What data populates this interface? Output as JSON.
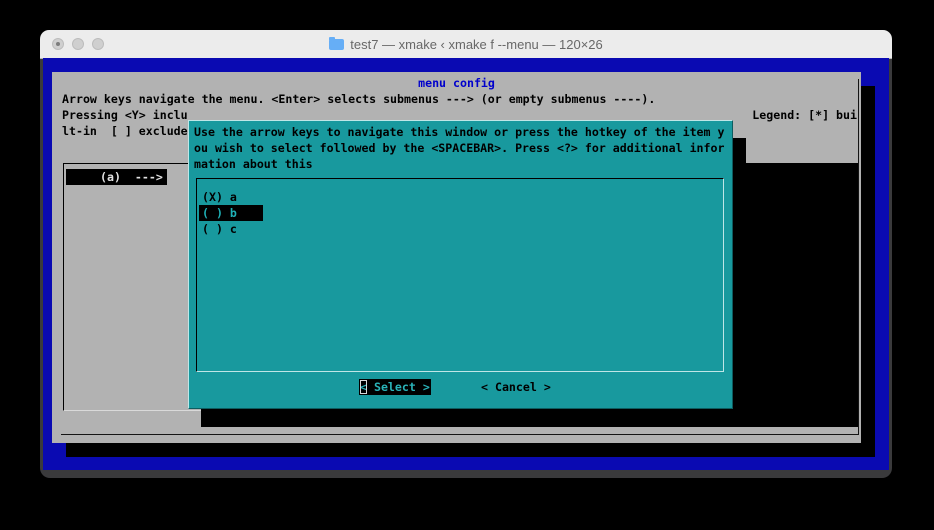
{
  "window": {
    "title": "test7 — xmake ‹ xmake f --menu — 120×26"
  },
  "screen": {
    "dialog_title": "menu config",
    "line1": "Arrow keys navigate the menu. <Enter> selects submenus ---> (or empty submenus ----).",
    "line2_left": "Pressing <Y> inclu",
    "line2_right": "Legend: [*] bui",
    "line3_left": "lt-in  [ ] exclude",
    "selected_menu_item": "(a)  --->",
    "colors": {
      "terminal_bg": "#0a0ab2",
      "dialog_bg": "#b2b2b2",
      "popup_bg": "#18999e",
      "dialog_title_fg": "#0000cc",
      "shadow": "#000000"
    }
  },
  "popup": {
    "text_lines": [
      "Use the arrow keys to navigate this window or press the hotkey of the item y",
      "ou wish to select followed by the <SPACEBAR>. Press <?> for additional infor",
      "mation about this"
    ],
    "options": [
      {
        "label": "(X) a"
      },
      {
        "label": "( ) b"
      },
      {
        "label": "( ) c"
      }
    ],
    "selected_option": "( ) b",
    "buttons": {
      "select_cursor": "<",
      "select_rest": " Select >",
      "cancel": "< Cancel >"
    }
  }
}
